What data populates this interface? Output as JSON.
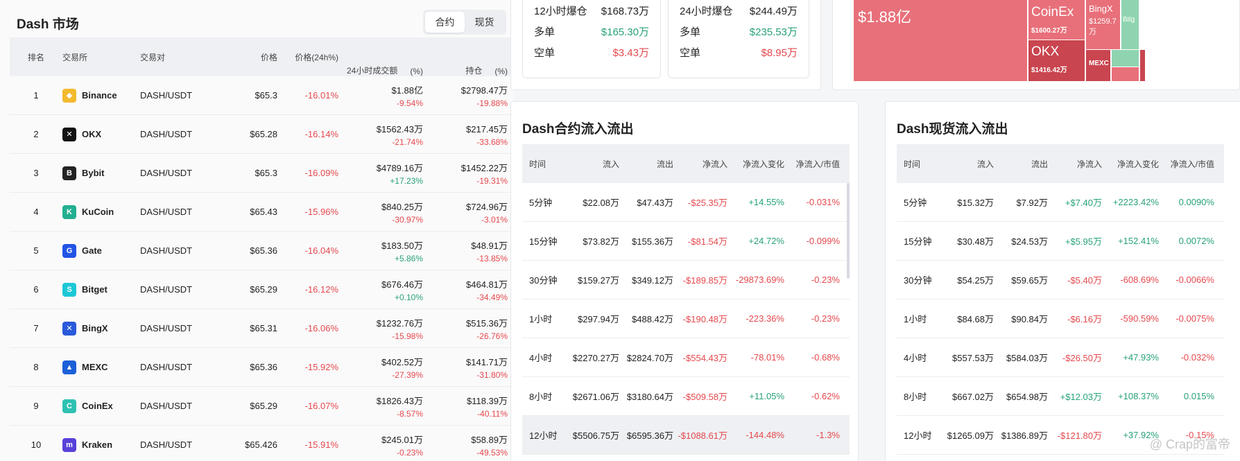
{
  "market": {
    "title": "Dash 市场",
    "tabs": [
      "合约",
      "现货"
    ],
    "headers": {
      "rank": "排名",
      "exchange": "交易所",
      "pair": "交易对",
      "price": "价格",
      "change": "价格(24h%)",
      "volume": "24小时成交额",
      "volume_pct": "(%)",
      "oi": "持仓",
      "oi_pct": "(%)"
    },
    "rows": [
      {
        "rank": "1",
        "exchange": "Binance",
        "pair": "DASH/USDT",
        "price": "$65.3",
        "change": "-16.01%",
        "volume": "$1.88亿",
        "volume_pct": "-9.54%",
        "oi": "$2798.47万",
        "oi_pct": "-19.88%"
      },
      {
        "rank": "2",
        "exchange": "OKX",
        "pair": "DASH/USDT",
        "price": "$65.28",
        "change": "-16.14%",
        "volume": "$1562.43万",
        "volume_pct": "-21.74%",
        "oi": "$217.45万",
        "oi_pct": "-33.68%"
      },
      {
        "rank": "3",
        "exchange": "Bybit",
        "pair": "DASH/USDT",
        "price": "$65.3",
        "change": "-16.09%",
        "volume": "$4789.16万",
        "volume_pct": "+17.23%",
        "oi": "$1452.22万",
        "oi_pct": "-19.31%"
      },
      {
        "rank": "4",
        "exchange": "KuCoin",
        "pair": "DASH/USDT",
        "price": "$65.43",
        "change": "-15.96%",
        "volume": "$840.25万",
        "volume_pct": "-30.97%",
        "oi": "$724.96万",
        "oi_pct": "-3.01%"
      },
      {
        "rank": "5",
        "exchange": "Gate",
        "pair": "DASH/USDT",
        "price": "$65.36",
        "change": "-16.04%",
        "volume": "$183.50万",
        "volume_pct": "+5.86%",
        "oi": "$48.91万",
        "oi_pct": "-13.85%"
      },
      {
        "rank": "6",
        "exchange": "Bitget",
        "pair": "DASH/USDT",
        "price": "$65.29",
        "change": "-16.12%",
        "volume": "$676.46万",
        "volume_pct": "+0.10%",
        "oi": "$464.81万",
        "oi_pct": "-34.49%"
      },
      {
        "rank": "7",
        "exchange": "BingX",
        "pair": "DASH/USDT",
        "price": "$65.31",
        "change": "-16.06%",
        "volume": "$1232.76万",
        "volume_pct": "-15.98%",
        "oi": "$515.36万",
        "oi_pct": "-26.76%"
      },
      {
        "rank": "8",
        "exchange": "MEXC",
        "pair": "DASH/USDT",
        "price": "$65.36",
        "change": "-15.92%",
        "volume": "$402.52万",
        "volume_pct": "-27.39%",
        "oi": "$141.71万",
        "oi_pct": "-31.80%"
      },
      {
        "rank": "9",
        "exchange": "CoinEx",
        "pair": "DASH/USDT",
        "price": "$65.29",
        "change": "-16.07%",
        "volume": "$1826.43万",
        "volume_pct": "-8.57%",
        "oi": "$118.39万",
        "oi_pct": "-40.11%"
      },
      {
        "rank": "10",
        "exchange": "Kraken",
        "pair": "DASH/USDT",
        "price": "$65.426",
        "change": "-15.91%",
        "volume": "$245.01万",
        "volume_pct": "-0.23%",
        "oi": "$58.89万",
        "oi_pct": "-49.53%"
      }
    ]
  },
  "liquidation": {
    "box12": [
      {
        "label": "12小时爆仓",
        "value": "$168.73万",
        "tone": "neutral"
      },
      {
        "label": "多单",
        "value": "$165.30万",
        "tone": "green"
      },
      {
        "label": "空单",
        "value": "$3.43万",
        "tone": "red"
      }
    ],
    "box24": [
      {
        "label": "24小时爆仓",
        "value": "$244.49万",
        "tone": "neutral"
      },
      {
        "label": "多单",
        "value": "$235.53万",
        "tone": "green"
      },
      {
        "label": "空单",
        "value": "$8.95万",
        "tone": "red"
      }
    ]
  },
  "treemap": {
    "binance_value": "$1.88亿",
    "coinex": {
      "name": "CoinEx",
      "value": "$1600.27万"
    },
    "okx": {
      "name": "OKX",
      "value": "$1416.42万"
    },
    "bingx": {
      "name": "BingX",
      "value": "$1259.7万"
    },
    "mexc": {
      "name": "MEXC"
    },
    "bitget": {
      "name": "Bitg"
    },
    "colors": {
      "red": "#e8707a",
      "dark_red": "#c9454f",
      "green": "#8fd4b0"
    }
  },
  "futures_flow": {
    "title": "Dash合约流入流出",
    "headers": {
      "time": "时间",
      "inflow": "流入",
      "outflow": "流出",
      "net": "净流入",
      "net_change": "净流入变化",
      "net_mc": "净流入/市值"
    },
    "rows": [
      {
        "time": "5分钟",
        "inflow": "$22.08万",
        "outflow": "$47.43万",
        "net": "-$25.35万",
        "net_change": "+14.55%",
        "net_mc": "-0.031%"
      },
      {
        "time": "15分钟",
        "inflow": "$73.82万",
        "outflow": "$155.36万",
        "net": "-$81.54万",
        "net_change": "+24.72%",
        "net_mc": "-0.099%"
      },
      {
        "time": "30分钟",
        "inflow": "$159.27万",
        "outflow": "$349.12万",
        "net": "-$189.85万",
        "net_change": "-29873.69%",
        "net_mc": "-0.23%"
      },
      {
        "time": "1小时",
        "inflow": "$297.94万",
        "outflow": "$488.42万",
        "net": "-$190.48万",
        "net_change": "-223.36%",
        "net_mc": "-0.23%"
      },
      {
        "time": "4小时",
        "inflow": "$2270.27万",
        "outflow": "$2824.70万",
        "net": "-$554.43万",
        "net_change": "-78.01%",
        "net_mc": "-0.68%"
      },
      {
        "time": "8小时",
        "inflow": "$2671.06万",
        "outflow": "$3180.64万",
        "net": "-$509.58万",
        "net_change": "+11.05%",
        "net_mc": "-0.62%"
      },
      {
        "time": "12小时",
        "inflow": "$5506.75万",
        "outflow": "$6595.36万",
        "net": "-$1088.61万",
        "net_change": "-144.48%",
        "net_mc": "-1.3%"
      }
    ]
  },
  "spot_flow": {
    "title": "Dash现货流入流出",
    "headers": {
      "time": "时间",
      "inflow": "流入",
      "outflow": "流出",
      "net": "净流入",
      "net_change": "净流入变化",
      "net_mc": "净流入/市值"
    },
    "rows": [
      {
        "time": "5分钟",
        "inflow": "$15.32万",
        "outflow": "$7.92万",
        "net": "+$7.40万",
        "net_change": "+2223.42%",
        "net_mc": "0.0090%"
      },
      {
        "time": "15分钟",
        "inflow": "$30.48万",
        "outflow": "$24.53万",
        "net": "+$5.95万",
        "net_change": "+152.41%",
        "net_mc": "0.0072%"
      },
      {
        "time": "30分钟",
        "inflow": "$54.25万",
        "outflow": "$59.65万",
        "net": "-$5.40万",
        "net_change": "-608.69%",
        "net_mc": "-0.0066%"
      },
      {
        "time": "1小时",
        "inflow": "$84.68万",
        "outflow": "$90.84万",
        "net": "-$6.16万",
        "net_change": "-590.59%",
        "net_mc": "-0.0075%"
      },
      {
        "time": "4小时",
        "inflow": "$557.53万",
        "outflow": "$584.03万",
        "net": "-$26.50万",
        "net_change": "+47.93%",
        "net_mc": "-0.032%"
      },
      {
        "time": "8小时",
        "inflow": "$667.02万",
        "outflow": "$654.98万",
        "net": "+$12.03万",
        "net_change": "+108.37%",
        "net_mc": "0.015%"
      },
      {
        "time": "12小时",
        "inflow": "$1265.09万",
        "outflow": "$1386.89万",
        "net": "-$121.80万",
        "net_change": "+37.92%",
        "net_mc": "-0.15%"
      }
    ]
  },
  "watermark": "@ Crap的富帝"
}
